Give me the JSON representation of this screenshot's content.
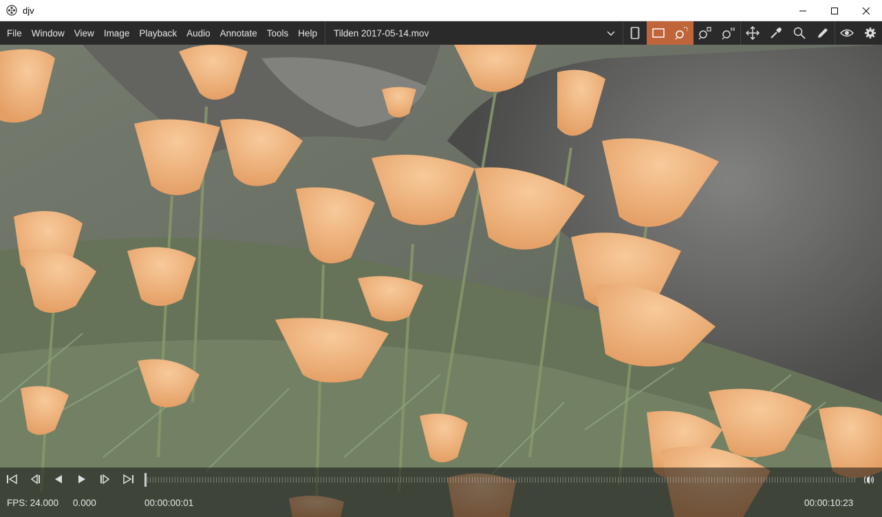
{
  "window": {
    "title": "djv",
    "icon": "djv-logo-icon"
  },
  "menubar": {
    "items": [
      "File",
      "Window",
      "View",
      "Image",
      "Playback",
      "Audio",
      "Annotate",
      "Tools",
      "Help"
    ],
    "file_title": "Tilden 2017-05-14.mov"
  },
  "toolbar": {
    "icons": [
      "dropdown-chevron-icon",
      "frame-icon",
      "fill-icon",
      "zoom-fit-icon",
      "zoom-frame-icon",
      "zoom-reset-icon",
      "pan-icon",
      "color-picker-icon",
      "magnify-icon",
      "annotate-pen-icon",
      "eye-icon",
      "settings-gear-icon"
    ],
    "accent": "#c0653a"
  },
  "timeline": {
    "fps_label": "FPS: 24.000",
    "speed": "0.000",
    "current_time": "00:00:00:01",
    "end_time": "00:00:10:23",
    "progress": 0.0
  }
}
